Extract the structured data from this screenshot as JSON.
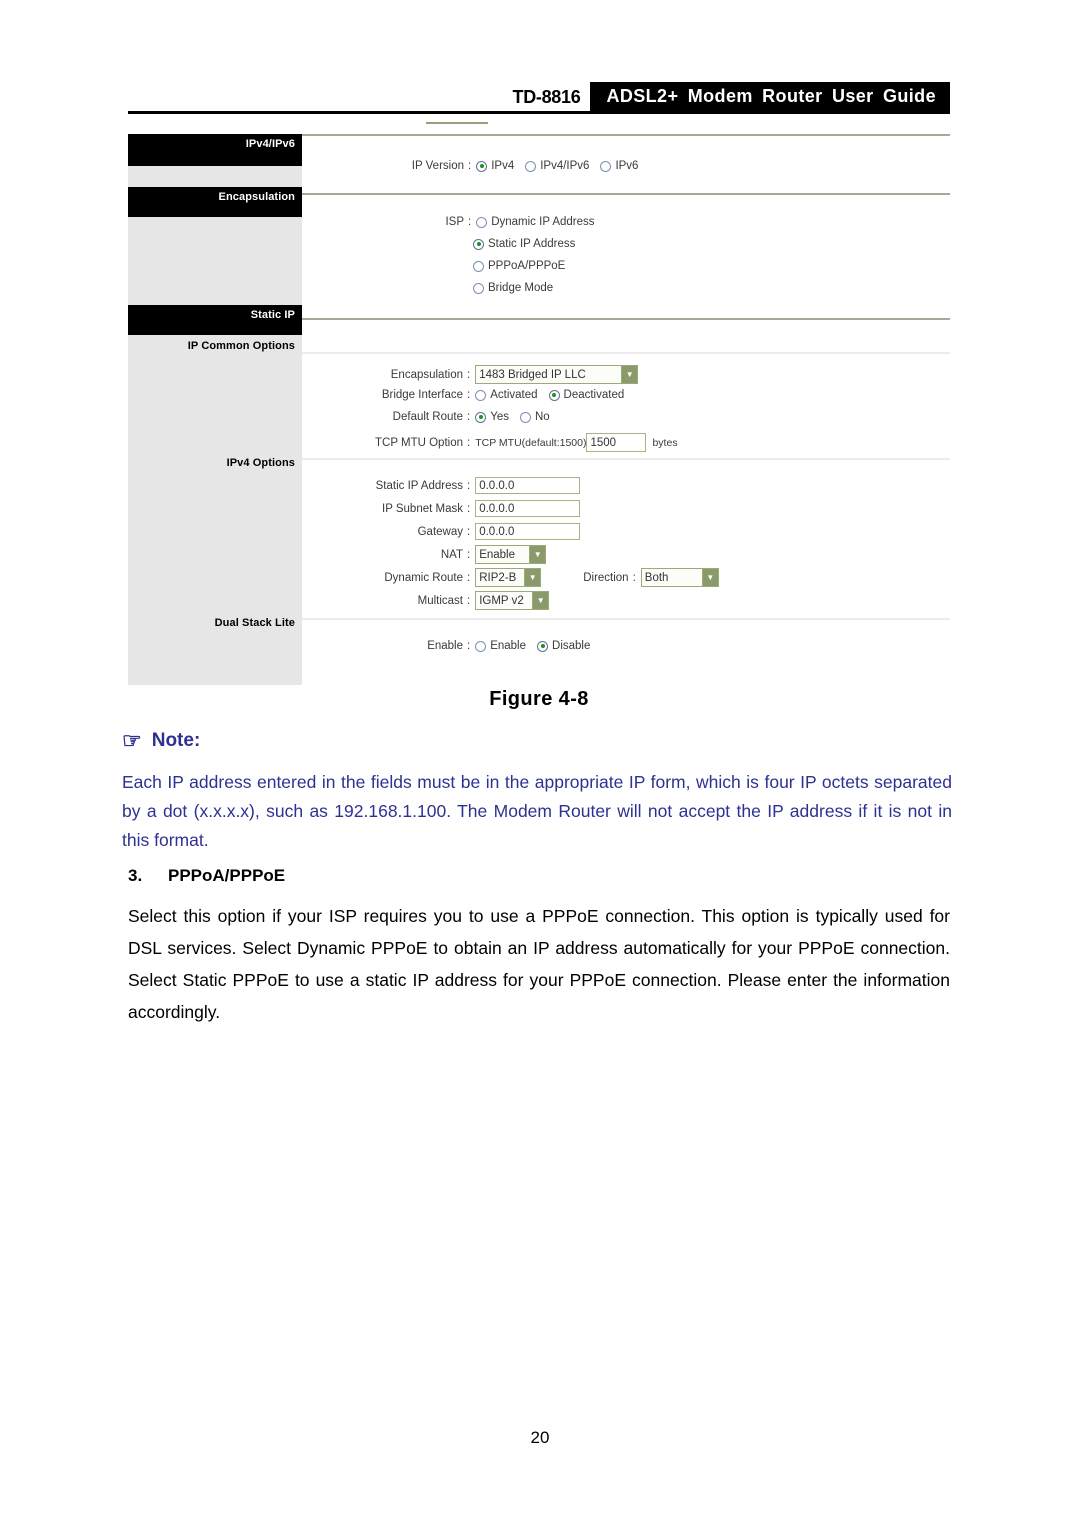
{
  "header": {
    "model": "TD-8816",
    "title": "ADSL2+ Modem Router User Guide"
  },
  "figure": {
    "caption": "Figure 4-8",
    "nav": [
      {
        "label": "IPv4/IPv6",
        "style": "black"
      },
      {
        "label": "Encapsulation",
        "style": "black"
      },
      {
        "label": "Static IP",
        "style": "black"
      },
      {
        "label": "IP Common Options",
        "style": "plain"
      },
      {
        "label": "IPv4 Options",
        "style": "plain"
      },
      {
        "label": "Dual Stack Lite",
        "style": "plain"
      }
    ],
    "ip_version": {
      "label": "IP Version",
      "options": [
        "IPv4",
        "IPv4/IPv6",
        "IPv6"
      ],
      "selected": "IPv4"
    },
    "isp": {
      "label": "ISP",
      "options": [
        "Dynamic IP Address",
        "Static IP Address",
        "PPPoA/PPPoE",
        "Bridge Mode"
      ],
      "selected": "Static IP Address"
    },
    "common": {
      "encapsulation_label": "Encapsulation",
      "encapsulation_value": "1483 Bridged IP LLC",
      "bridge_interface_label": "Bridge Interface",
      "bridge_interface_options": [
        "Activated",
        "Deactivated"
      ],
      "bridge_interface_selected": "Deactivated",
      "default_route_label": "Default Route",
      "default_route_options": [
        "Yes",
        "No"
      ],
      "default_route_selected": "Yes",
      "tcp_mtu_label": "TCP MTU Option",
      "tcp_mtu_prefix": "TCP MTU(default:1500)",
      "tcp_mtu_value": "1500",
      "tcp_mtu_unit": "bytes"
    },
    "ipv4": {
      "static_ip_label": "Static IP Address",
      "static_ip_value": "0.0.0.0",
      "subnet_label": "IP Subnet Mask",
      "subnet_value": "0.0.0.0",
      "gateway_label": "Gateway",
      "gateway_value": "0.0.0.0",
      "nat_label": "NAT",
      "nat_value": "Enable",
      "dynamic_route_label": "Dynamic Route",
      "dynamic_route_value": "RIP2-B",
      "direction_label": "Direction",
      "direction_value": "Both",
      "multicast_label": "Multicast",
      "multicast_value": "IGMP v2"
    },
    "dslite": {
      "label": "Enable",
      "options": [
        "Enable",
        "Disable"
      ],
      "selected": "Disable"
    }
  },
  "note": {
    "icon": "pointing-hand-icon",
    "heading": "Note:",
    "text": "Each IP address entered in the fields must be in the appropriate IP form, which is four IP octets separated by a dot (x.x.x.x), such as 192.168.1.100. The Modem Router will not accept the IP address if it is not in this format."
  },
  "section3": {
    "number": "3.",
    "title": "PPPoA/PPPoE",
    "body": "Select this option if your ISP requires you to use a PPPoE connection. This option is typically used for DSL services. Select Dynamic PPPoE to obtain an IP address automatically for your PPPoE connection. Select Static PPPoE to use a static IP address for your PPPoE connection. Please enter the information accordingly."
  },
  "page_number": "20",
  "colors": {
    "note_blue": "#2e3192",
    "panel_gray": "#e6e6e6",
    "separator_major": "#a9a799",
    "input_border": "#a4b581",
    "select_arrow": "#8a9a6b",
    "radio_selected_dot": "#1f8f2a"
  }
}
